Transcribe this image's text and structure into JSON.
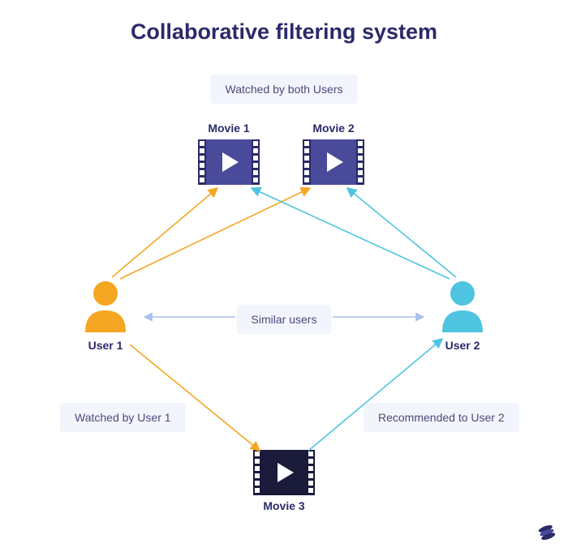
{
  "title": "Collaborative filtering system",
  "badges": {
    "watched_both": "Watched by both Users",
    "similar": "Similar users",
    "watched_u1": "Watched by User 1",
    "rec_u2": "Recommended to User 2"
  },
  "movies": {
    "m1": "Movie 1",
    "m2": "Movie 2",
    "m3": "Movie 3"
  },
  "users": {
    "u1": "User 1",
    "u2": "User 2"
  },
  "colors": {
    "orange": "#f5a623",
    "cyan": "#4ec4e0",
    "navy": "#2a2a6a",
    "film_purple": "#4a4a9a",
    "film_dark": "#1a1a3a",
    "badge_bg": "#f3f5fc",
    "similar_arrow": "#a8c0e8"
  }
}
